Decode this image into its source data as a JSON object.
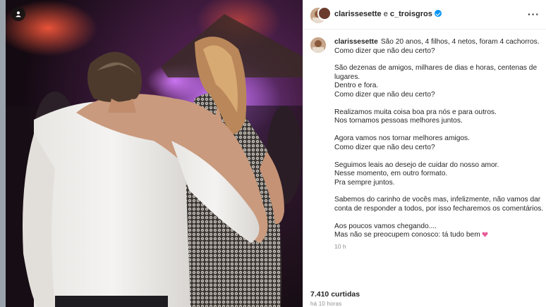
{
  "post": {
    "header": {
      "author": "clarissesette",
      "connector": " e ",
      "coauthor": "c_troisgros",
      "more_icon": "more-horizontal-icon"
    },
    "caption": {
      "author": "clarissesette",
      "paragraphs": [
        "São 20 anos, 4 filhos, 4 netos, foram 4 cachorros.\nComo dizer que não deu certo?",
        "São dezenas de amigos, milhares de dias e horas, centenas de lugares.\nDentro e fora.\nComo dizer que não deu certo?",
        "Realizamos muita coisa boa pra nós e para outros.\nNos tornamos pessoas melhores juntos.",
        "Agora vamos nos tornar melhores amigos.\nComo dizer que não deu certo?",
        "Seguimos leais ao desejo de cuidar do nosso amor.\nNesse momento, em outro formato.\nPra sempre juntos.",
        "Sabemos do carinho de vocês mas, infelizmente, não vamos dar conta de responder a todos, por isso fecharemos os comentários."
      ],
      "last_paragraph": "Aos poucos vamos chegando....\nMas não se preocupem conosco: tá tudo bem",
      "emoji": "heart-icon",
      "time": "10 h"
    },
    "likes": "7.410 curtidas",
    "posted_ago": "há 10 horas"
  },
  "colors": {
    "accent": "#0095f6",
    "text": "#262626",
    "muted": "#8e8e8e",
    "heart": "#e85d97"
  }
}
